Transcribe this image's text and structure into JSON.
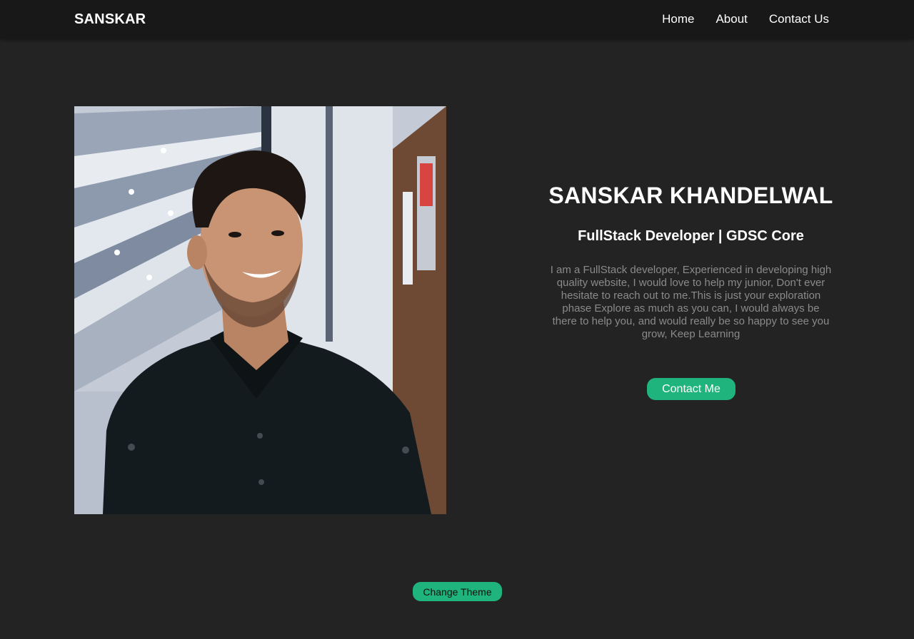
{
  "navbar": {
    "brand": "SANSKAR",
    "links": [
      "Home",
      "About",
      "Contact Us"
    ]
  },
  "profile": {
    "photo_icon": "portrait-photo",
    "name": "SANSKAR KHANDELWAL",
    "role": "FullStack Developer | GDSC Core",
    "bio": "I am a FullStack developer, Experienced in developing high quality website, I would love to help my junior, Don't ever hesitate to reach out to me.This is just your exploration phase Explore as much as you can, I would always be there to help you, and would really be so happy to see you grow, Keep Learning",
    "contact_label": "Contact Me"
  },
  "footer": {
    "theme_label": "Change Theme"
  },
  "colors": {
    "background": "#232323",
    "navbar": "#181818",
    "accent": "#1fb47e",
    "muted_text": "#8a8a8a"
  }
}
